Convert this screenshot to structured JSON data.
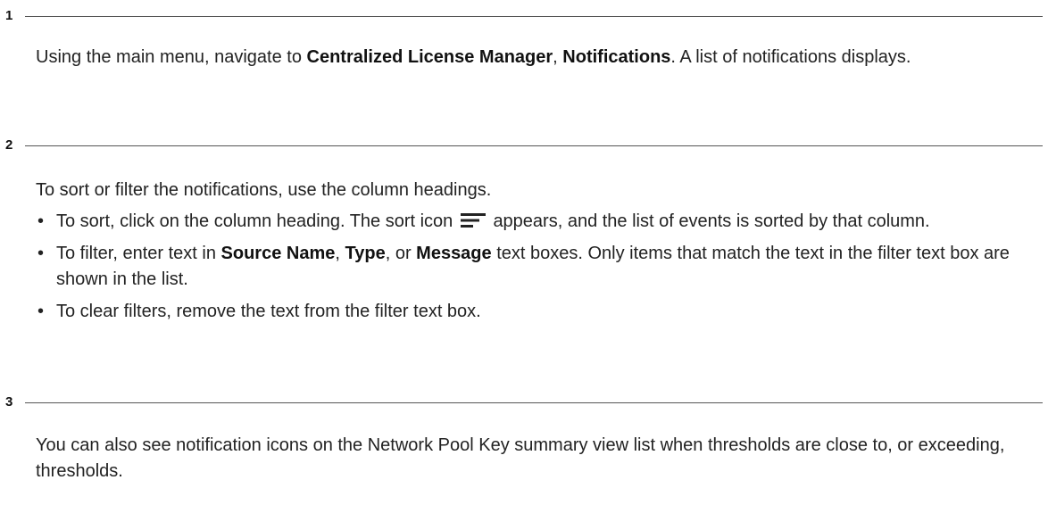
{
  "steps": [
    {
      "number": "1",
      "parts": [
        {
          "text": "Using the main menu, navigate to "
        },
        {
          "text": "Centralized License Manager",
          "bold": true
        },
        {
          "text": ", "
        },
        {
          "text": "Notifications",
          "bold": true
        },
        {
          "text": ". A list of notifications displays."
        }
      ]
    },
    {
      "number": "2",
      "intro": "To sort or filter the notifications, use the column headings.",
      "bullets": [
        {
          "pre": "To sort, click on the column heading. The sort icon",
          "icon": "sort-icon",
          "post": "appears, and the list of events is sorted by that column."
        },
        {
          "parts": [
            {
              "text": "To filter, enter text in "
            },
            {
              "text": "Source Name",
              "bold": true
            },
            {
              "text": ", "
            },
            {
              "text": "Type",
              "bold": true
            },
            {
              "text": ", or "
            },
            {
              "text": "Message",
              "bold": true
            },
            {
              "text": " text boxes. Only items that match the text in the filter text box are shown in the list."
            }
          ]
        },
        {
          "parts": [
            {
              "text": "To clear filters, remove the text from the filter text box."
            }
          ]
        }
      ]
    },
    {
      "number": "3",
      "parts": [
        {
          "text": "You can also see notification icons on the Network Pool Key summary view list when thresholds are close to, or exceeding, thresholds."
        }
      ]
    }
  ]
}
